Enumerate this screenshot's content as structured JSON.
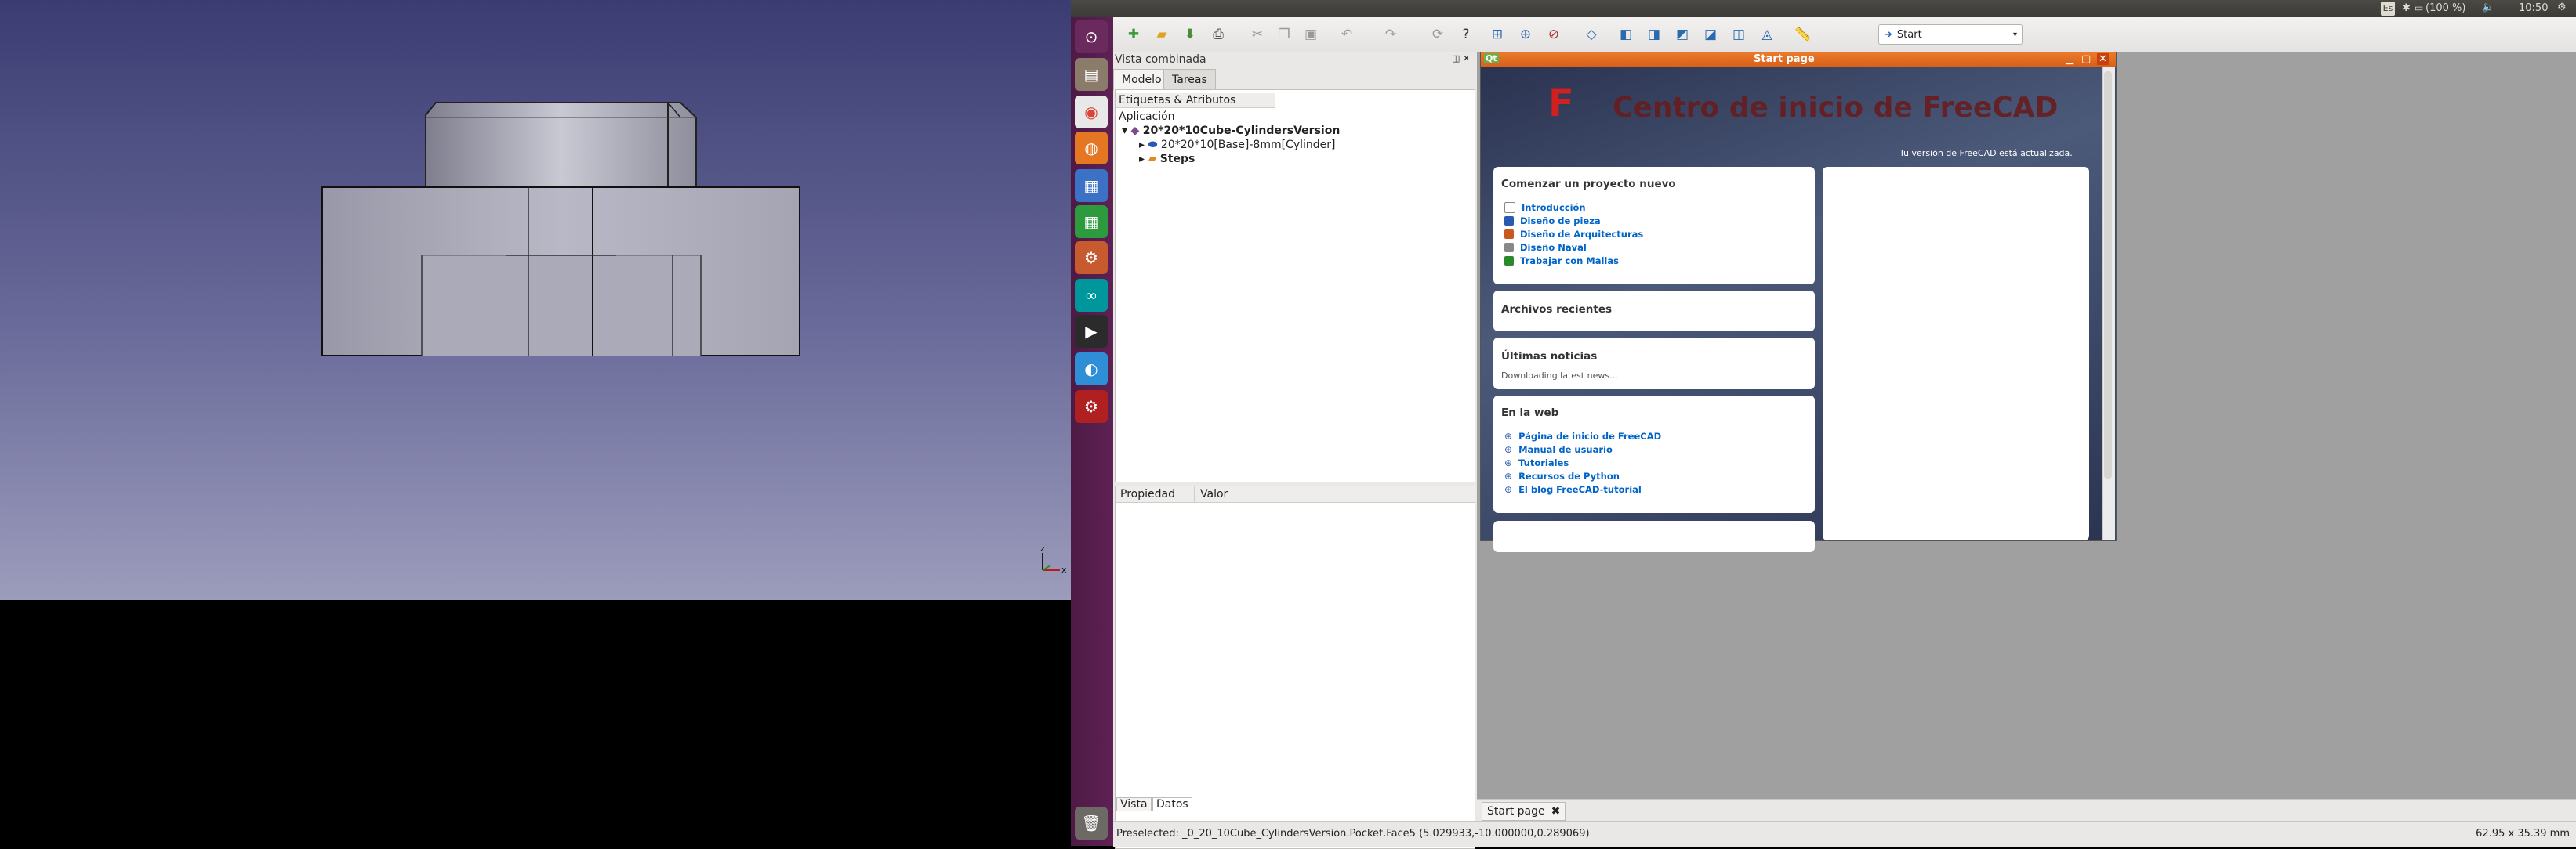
{
  "top_panel": {
    "keyboard": "Es",
    "battery": "(100 %)",
    "clock": "10:50"
  },
  "toolbar": {
    "workbench_selected": "Start"
  },
  "combo": {
    "title": "Vista combinada",
    "tabs": [
      "Modelo",
      "Tareas"
    ],
    "labels_header": "Etiquetas & Atributos",
    "app_label": "Aplicación",
    "tree": {
      "document": "20*20*10Cube-CylindersVersion",
      "child1": "20*20*10[Base]-8mm[Cylinder]",
      "child2": "Steps"
    },
    "prop_header": [
      "Propiedad",
      "Valor"
    ],
    "bottom_tabs": [
      "Vista",
      "Datos"
    ]
  },
  "start_page": {
    "window_title": "Start page",
    "heading": "Centro de inicio de FreeCAD",
    "status": "Tu versión de FreeCAD está actualizada.",
    "new_project": {
      "title": "Comenzar un proyecto nuevo",
      "items": [
        "Introducción",
        "Diseño de pieza",
        "Diseño de Arquitecturas",
        "Diseño Naval",
        "Trabajar con Mallas"
      ]
    },
    "recent": {
      "title": "Archivos recientes"
    },
    "news": {
      "title": "Últimas noticias",
      "body": "Downloading latest news..."
    },
    "web": {
      "title": "En la web",
      "items": [
        "Página de inicio de FreeCAD",
        "Manual de usuario",
        "Tutoriales",
        "Recursos de Python",
        "El blog FreeCAD-tutorial"
      ]
    },
    "tab_label": "Start page"
  },
  "status_bar": {
    "preselected": "Preselected: _0_20_10Cube_CylindersVersion.Pocket.Face5 (5.029933,-10.000000,0.289069)",
    "dimensions": "62.95 x 35.39 mm"
  },
  "axis": {
    "x": "x",
    "z": "z"
  },
  "colors": {
    "launcher": "#5e2153",
    "link": "#0064c8",
    "viewport_top": "#3b3c72",
    "viewport_bottom": "#9c9cbc"
  }
}
